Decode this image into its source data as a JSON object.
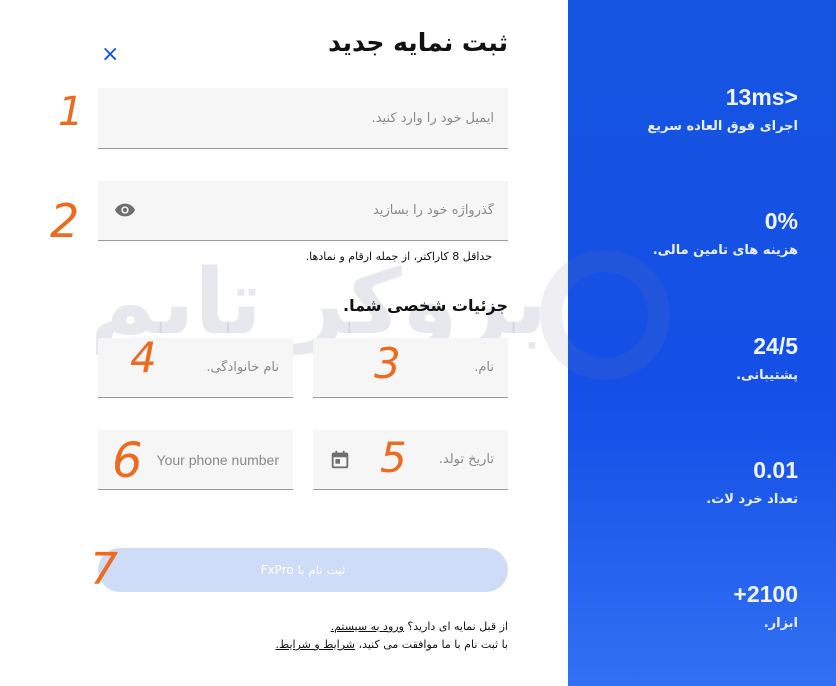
{
  "header": {
    "title": "ثبت نمایه جدید",
    "close_glyph": "×"
  },
  "form": {
    "email": {
      "placeholder": "ایمیل خود را وارد کنید.",
      "value": ""
    },
    "password": {
      "placeholder": "گذرواژه خود را بسازید",
      "value": ""
    },
    "password_hint": "حداقل 8 کاراکتر، از جمله ارقام و نمادها.",
    "section_title": "جزئیات شخصی شما.",
    "first_name": {
      "placeholder": "نام.",
      "value": ""
    },
    "last_name": {
      "placeholder": "نام خانوادگی.",
      "value": ""
    },
    "birth_date": {
      "placeholder": "تاریخ تولد.",
      "value": ""
    },
    "phone": {
      "placeholder": "Your phone number",
      "value": ""
    },
    "submit_label": "ثبت نام با FxPro"
  },
  "footer": {
    "line1_text": "از قبل نمایه ای دارید؟",
    "login_link": "ورود به سیستم.",
    "line2_text": "با ثبت نام با ما موافقت می کنید،",
    "terms_link": "شرایط و شرایط."
  },
  "stats": [
    {
      "value": "13ms>",
      "label": "اجرای فوق العاده سریع"
    },
    {
      "value": "0%",
      "label": "هزینه های تامین مالی."
    },
    {
      "value": "24/5",
      "label": "پشتیبانی."
    },
    {
      "value": "0.01",
      "label": "تعداد خرد لات."
    },
    {
      "value": "+2100",
      "label": "ابزار."
    }
  ],
  "watermark": {
    "text": "بروکر تایم"
  },
  "annotations": [
    "1",
    "2",
    "3",
    "4",
    "5",
    "6",
    "7"
  ],
  "icons": {
    "eye": "eye-icon",
    "calendar": "calendar-icon",
    "close": "close-icon"
  },
  "colors": {
    "brand_blue": "#1554e0",
    "submit_disabled": "#cfdcf7",
    "annotation": "#ee6a1e",
    "field_bg": "#f6f6f6"
  }
}
